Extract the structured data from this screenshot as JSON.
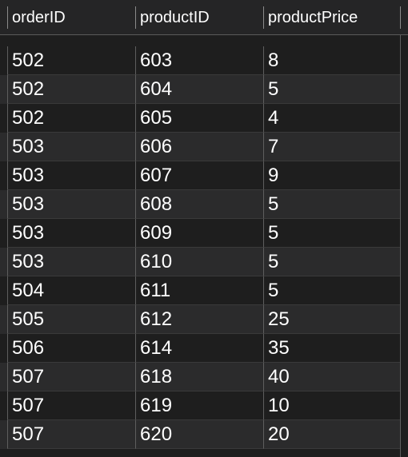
{
  "table": {
    "columns": [
      "orderID",
      "productID",
      "productPrice"
    ],
    "rows": [
      [
        "502",
        "603",
        "8"
      ],
      [
        "502",
        "604",
        "5"
      ],
      [
        "502",
        "605",
        "4"
      ],
      [
        "503",
        "606",
        "7"
      ],
      [
        "503",
        "607",
        "9"
      ],
      [
        "503",
        "608",
        "5"
      ],
      [
        "503",
        "609",
        "5"
      ],
      [
        "503",
        "610",
        "5"
      ],
      [
        "504",
        "611",
        "5"
      ],
      [
        "505",
        "612",
        "25"
      ],
      [
        "506",
        "614",
        "35"
      ],
      [
        "507",
        "618",
        "40"
      ],
      [
        "507",
        "619",
        "10"
      ],
      [
        "507",
        "620",
        "20"
      ]
    ]
  },
  "colors": {
    "background": "#1e1e1e",
    "row_alt": "#2b2b2c",
    "header": "#252526",
    "grid_line": "#5e5e5e",
    "text": "#ffffff"
  }
}
